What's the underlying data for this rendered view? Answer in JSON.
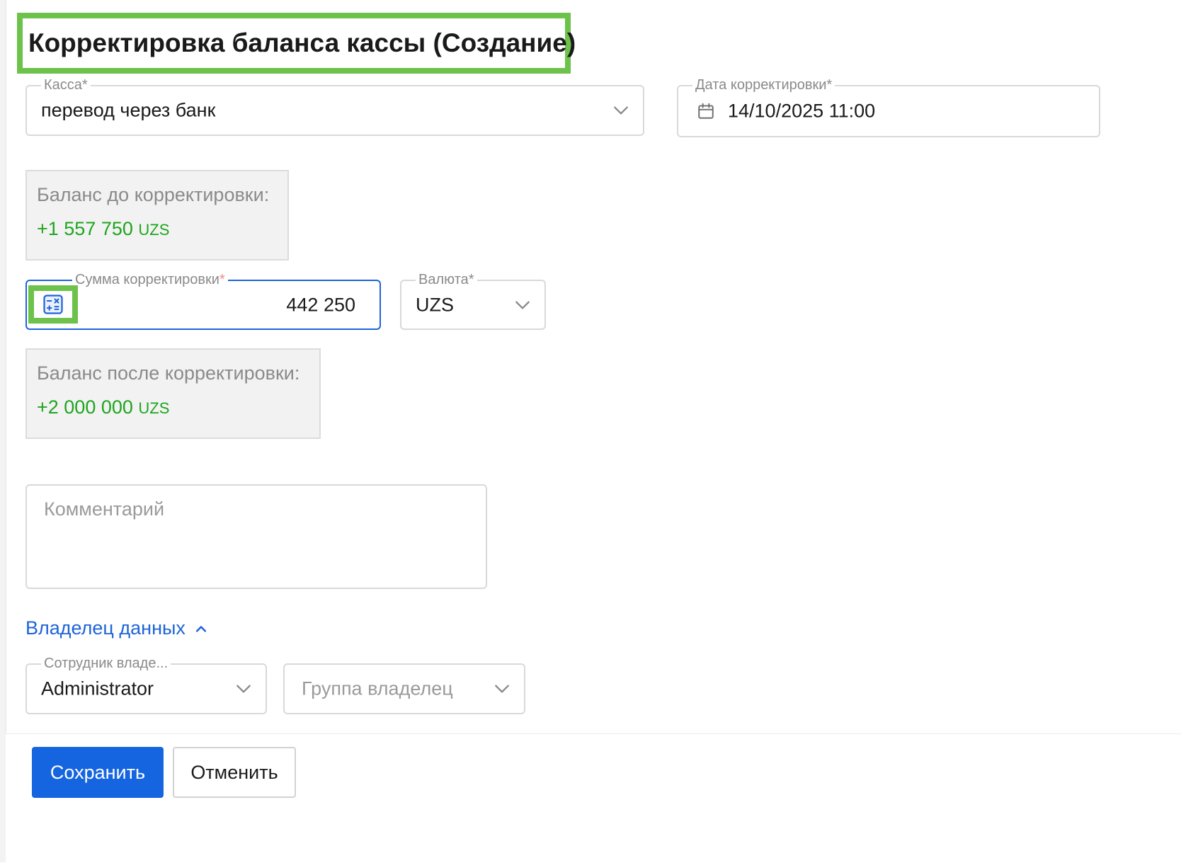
{
  "page": {
    "title": "Корректировка баланса кассы (Создание)"
  },
  "form": {
    "cashbox": {
      "label": "Касса*",
      "value": "перевод через банк"
    },
    "date": {
      "label": "Дата корректировки*",
      "value": "14/10/2025 11:00"
    },
    "balance_before": {
      "label": "Баланс до корректировки:",
      "amount": "+1 557 750",
      "currency": "UZS"
    },
    "amount": {
      "label": "Сумма корректировки",
      "required_mark": "*",
      "value": "442 250"
    },
    "currency": {
      "label": "Валюта*",
      "value": "UZS"
    },
    "balance_after": {
      "label": "Баланс после корректировки:",
      "amount": "+2 000 000",
      "currency": "UZS"
    },
    "comment": {
      "placeholder": "Комментарий"
    },
    "owner": {
      "toggle_label": "Владелец данных",
      "employee_label": "Сотрудник владе...",
      "employee_value": "Administrator",
      "group_placeholder": "Группа владелец"
    }
  },
  "footer": {
    "save_label": "Сохранить",
    "cancel_label": "Отменить"
  },
  "colors": {
    "primary": "#1565e0",
    "highlight": "#6cc24a",
    "positive": "#1ea51e",
    "link": "#1e64d8"
  },
  "icons": {
    "calendar": "calendar-icon",
    "calculator": "calculator-icon",
    "chevron_down": "chevron-down-icon",
    "chevron_up": "chevron-up-icon"
  }
}
